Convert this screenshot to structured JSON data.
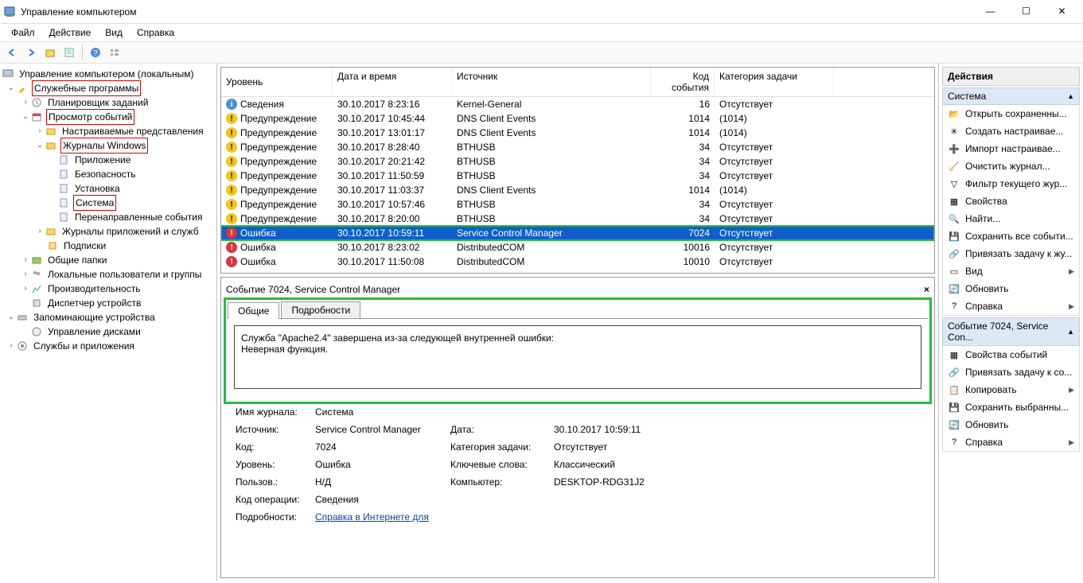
{
  "window": {
    "title": "Управление компьютером"
  },
  "menu": {
    "file": "Файл",
    "action": "Действие",
    "view": "Вид",
    "help": "Справка"
  },
  "tree": {
    "root": "Управление компьютером (локальным)",
    "system_tools": "Служебные программы",
    "task_scheduler": "Планировщик заданий",
    "event_viewer": "Просмотр событий",
    "custom_views": "Настраиваемые представления",
    "windows_logs": "Журналы Windows",
    "application": "Приложение",
    "security": "Безопасность",
    "setup": "Установка",
    "system": "Система",
    "forwarded": "Перенаправленные события",
    "app_logs": "Журналы приложений и служб",
    "subscriptions": "Подписки",
    "shared_folders": "Общие папки",
    "local_users": "Локальные пользователи и группы",
    "performance": "Производительность",
    "device_mgr": "Диспетчер устройств",
    "storage": "Запоминающие устройства",
    "disk_mgmt": "Управление дисками",
    "services_apps": "Службы и приложения"
  },
  "events": {
    "columns": {
      "level": "Уровень",
      "datetime": "Дата и время",
      "source": "Источник",
      "event_id": "Код события",
      "category": "Категория задачи"
    },
    "levels": {
      "info": "Сведения",
      "warn": "Предупреждение",
      "err": "Ошибка"
    },
    "rows": [
      {
        "lev": "info",
        "dt": "30.10.2017 8:23:16",
        "src": "Kernel-General",
        "id": "16",
        "cat": "Отсутствует"
      },
      {
        "lev": "warn",
        "dt": "30.10.2017 10:45:44",
        "src": "DNS Client Events",
        "id": "1014",
        "cat": "(1014)"
      },
      {
        "lev": "warn",
        "dt": "30.10.2017 13:01:17",
        "src": "DNS Client Events",
        "id": "1014",
        "cat": "(1014)"
      },
      {
        "lev": "warn",
        "dt": "30.10.2017 8:28:40",
        "src": "BTHUSB",
        "id": "34",
        "cat": "Отсутствует"
      },
      {
        "lev": "warn",
        "dt": "30.10.2017 20:21:42",
        "src": "BTHUSB",
        "id": "34",
        "cat": "Отсутствует"
      },
      {
        "lev": "warn",
        "dt": "30.10.2017 11:50:59",
        "src": "BTHUSB",
        "id": "34",
        "cat": "Отсутствует"
      },
      {
        "lev": "warn",
        "dt": "30.10.2017 11:03:37",
        "src": "DNS Client Events",
        "id": "1014",
        "cat": "(1014)"
      },
      {
        "lev": "warn",
        "dt": "30.10.2017 10:57:46",
        "src": "BTHUSB",
        "id": "34",
        "cat": "Отсутствует"
      },
      {
        "lev": "warn",
        "dt": "30.10.2017 8:20:00",
        "src": "BTHUSB",
        "id": "34",
        "cat": "Отсутствует"
      },
      {
        "lev": "err",
        "dt": "30.10.2017 10:59:11",
        "src": "Service Control Manager",
        "id": "7024",
        "cat": "Отсутствует",
        "sel": true,
        "hl": true
      },
      {
        "lev": "err",
        "dt": "30.10.2017 8:23:02",
        "src": "DistributedCOM",
        "id": "10016",
        "cat": "Отсутствует"
      },
      {
        "lev": "err",
        "dt": "30.10.2017 11:50:08",
        "src": "DistributedCOM",
        "id": "10010",
        "cat": "Отсутствует"
      }
    ]
  },
  "detail": {
    "title": "Событие 7024, Service Control Manager",
    "tab_general": "Общие",
    "tab_details": "Подробности",
    "message1": "Служба \"Apache2.4\" завершена из-за следующей внутренней ошибки:",
    "message2": "Неверная функция.",
    "labels": {
      "logname": "Имя журнала:",
      "logname_v": "Система",
      "source": "Источник:",
      "source_v": "Service Control Manager",
      "date": "Дата:",
      "date_v": "30.10.2017 10:59:11",
      "code": "Код:",
      "code_v": "7024",
      "cat": "Категория задачи:",
      "cat_v": "Отсутствует",
      "level": "Уровень:",
      "level_v": "Ошибка",
      "keywords": "Ключевые слова:",
      "keywords_v": "Классический",
      "user": "Пользов.:",
      "user_v": "Н/Д",
      "computer": "Компьютер:",
      "computer_v": "DESKTOP-RDG31J2",
      "opcode": "Код операции:",
      "opcode_v": "Сведения",
      "more": "Подробности:",
      "more_link": "Справка в Интернете для"
    }
  },
  "actions": {
    "title": "Действия",
    "sec1": "Система",
    "items1": [
      "Открыть сохраненны...",
      "Создать настраивае...",
      "Импорт настраивае...",
      "Очистить журнал...",
      "Фильтр текущего жур...",
      "Свойства",
      "Найти...",
      "Сохранить все событи...",
      "Привязать задачу к жу...",
      "Вид",
      "Обновить",
      "Справка"
    ],
    "sec2": "Событие 7024, Service Con...",
    "items2": [
      "Свойства событий",
      "Привязать задачу к со...",
      "Копировать",
      "Сохранить выбранны...",
      "Обновить",
      "Справка"
    ]
  }
}
